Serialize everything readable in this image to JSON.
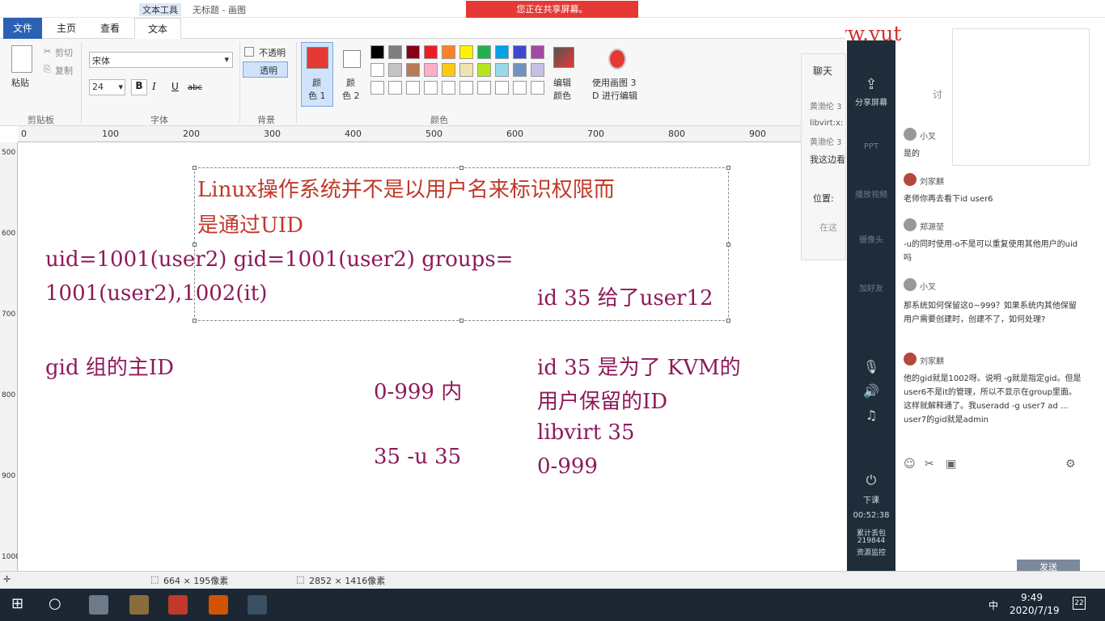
{
  "window": {
    "title_tool": "文本工具",
    "title": "无标题 - 画图",
    "share_banner": "您正在共享屏幕。"
  },
  "tabs": {
    "file": "文件",
    "home": "主页",
    "view": "查看",
    "text": "文本"
  },
  "clipboard": {
    "paste": "粘贴",
    "cut": "剪切",
    "copy": "复制",
    "group": "剪贴板"
  },
  "font": {
    "family": "宋体",
    "size": "24",
    "bold": "B",
    "italic": "I",
    "underline": "U",
    "strike": "abc",
    "group": "字体"
  },
  "background": {
    "opaque": "不透明",
    "transparent": "透明",
    "group": "背景"
  },
  "colors": {
    "color1": "颜\n色 1",
    "color1_a": "颜",
    "color1_b": "色 1",
    "color2_a": "颜",
    "color2_b": "色 2",
    "edit_a": "编辑",
    "edit_b": "颜色",
    "paint3d_a": "使用画图 3",
    "paint3d_b": "D 进行编辑",
    "group": "颜色",
    "palette": [
      "#000000",
      "#7f7f7f",
      "#880015",
      "#ed1c24",
      "#ff7f27",
      "#fff200",
      "#22b14c",
      "#00a2e8",
      "#3f48cc",
      "#a349a4",
      "#ffffff",
      "#c3c3c3",
      "#b97a57",
      "#ffaec9",
      "#ffc90e",
      "#efe4b0",
      "#b5e61d",
      "#99d9ea",
      "#7092be",
      "#c8bfe7"
    ],
    "primary": "#e53935",
    "secondary": "#ffffff"
  },
  "ruler": {
    "h": [
      "0",
      "100",
      "200",
      "300",
      "400",
      "500",
      "600",
      "700",
      "800",
      "900"
    ],
    "v": [
      "500",
      "600",
      "700",
      "800",
      "900",
      "1000"
    ]
  },
  "canvas": {
    "line1": "Linux操作系统并不是以用户名来标识权限而",
    "line2": "是通过UID",
    "line3": "uid=1001(user2) gid=1001(user2) groups=",
    "line4": "1001(user2),1002(it)",
    "line5": "id 35 给了user12",
    "line6": "gid 组的主ID",
    "line7": "id  35 是为了 KVM的",
    "line8": "0-999 内",
    "line9": "用户保留的ID",
    "line10": "libvirt 35",
    "line11": "35 -u 35",
    "line12": "0-999"
  },
  "status": {
    "selection": "664 × 195像素",
    "size": "2852 × 1416像素"
  },
  "chat": {
    "title": "聊天",
    "l1": "黄渤伦 3",
    "l2": "libvirt:x:",
    "l3": "黄渤伦 3",
    "l4": "我这边看",
    "pos": "位置:",
    "hint": "在这"
  },
  "sidebar": {
    "share": "分享屏幕",
    "ppt": "PPT",
    "video": "播放视频",
    "camera": "摄像头",
    "add": "加好友",
    "end": "下课",
    "time": "00:52:38",
    "monitor1": "累计丢包",
    "monitor2": "219844",
    "monitor3": "资源监控"
  },
  "qa_tab": "讨",
  "messages": [
    {
      "user": "小叉",
      "text": "是的"
    },
    {
      "user": "刘家麒",
      "text": "老师你再去看下id user6"
    },
    {
      "user": "郑源堃",
      "text": "-u的同时使用-o不是可以重复使用其他用户的uid吗"
    },
    {
      "user": "小叉",
      "text": "那系统如何保留这0~999？如果系统内其他保留用户需要创建时，创建不了，如何处理?"
    },
    {
      "user": "刘家麒",
      "text": "他的gid就是1002呀。说明 -g就是指定gid。但是user6不是it的管理，所以不显示在group里面。这样就解释通了。我useradd -g user7 ad ... user7的gid就是admin"
    }
  ],
  "send": "发送",
  "watermark": "誉天教育 www.yut",
  "tray": {
    "time": "9:49",
    "date": "2020/7/19",
    "ime": "中",
    "badge": "22"
  }
}
